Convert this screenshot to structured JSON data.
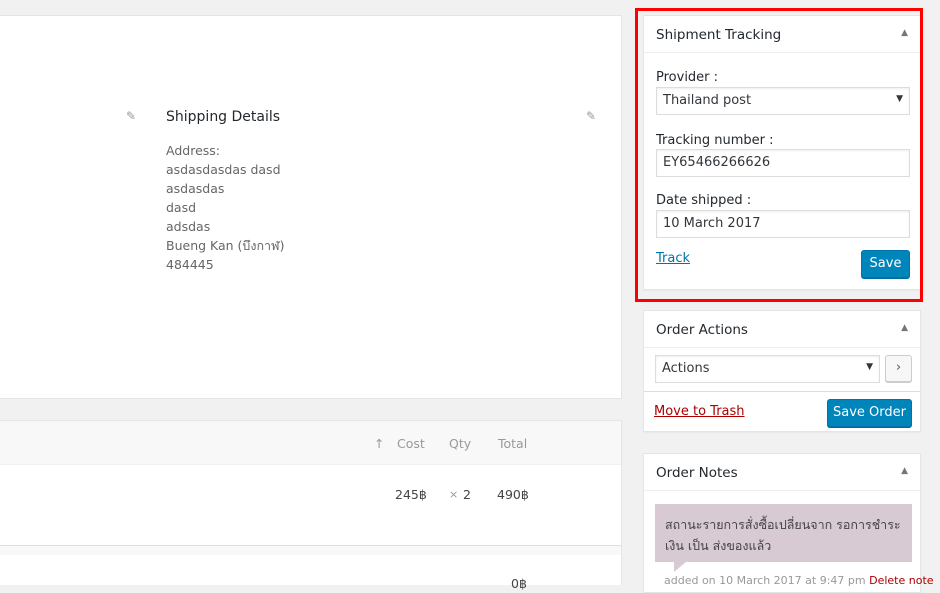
{
  "order_data": {
    "shipping": {
      "title": "Shipping Details",
      "address_label": "Address:",
      "address_lines": [
        "asdasdasdas dasd",
        "asdasdas",
        "dasd",
        "adsdas",
        "Bueng Kan (บึงกาฬ)",
        "484445"
      ],
      "edit_icon": "pencil-icon"
    },
    "billing_edit_icon": "pencil-icon"
  },
  "items": {
    "columns": {
      "sort": "↑",
      "cost": "Cost",
      "qty": "Qty",
      "total": "Total"
    },
    "rows": [
      {
        "cost": "245฿",
        "qty_prefix": "×",
        "qty": "2",
        "total": "490฿"
      }
    ],
    "next_row_total": "0฿"
  },
  "shipment_tracking": {
    "title": "Shipment Tracking",
    "provider_label": "Provider :",
    "provider_value": "Thailand post",
    "tracking_label": "Tracking number :",
    "tracking_value": "EY65466266626",
    "date_label": "Date shipped :",
    "date_value": "10 March 2017",
    "track_link": "Track",
    "save_button": "Save"
  },
  "order_actions": {
    "title": "Order Actions",
    "action_select": "Actions",
    "go_button": "›",
    "trash_link": "Move to Trash",
    "save_button": "Save Order"
  },
  "order_notes": {
    "title": "Order Notes",
    "notes": [
      {
        "text": "สถานะรายการสั่งซื้อเปลี่ยนจาก รอการชำระเงิน เป็น ส่งของแล้ว",
        "meta": "added on 10 March 2017 at 9:47 pm",
        "delete_link": "Delete note"
      }
    ]
  },
  "icons": {
    "toggle": "▲",
    "select_arrow": "▼",
    "pencil": "✎"
  },
  "colors": {
    "primary": "#0085ba",
    "highlight": "#ff0000",
    "note_bg": "#d7cad2",
    "danger": "#aa0000"
  }
}
